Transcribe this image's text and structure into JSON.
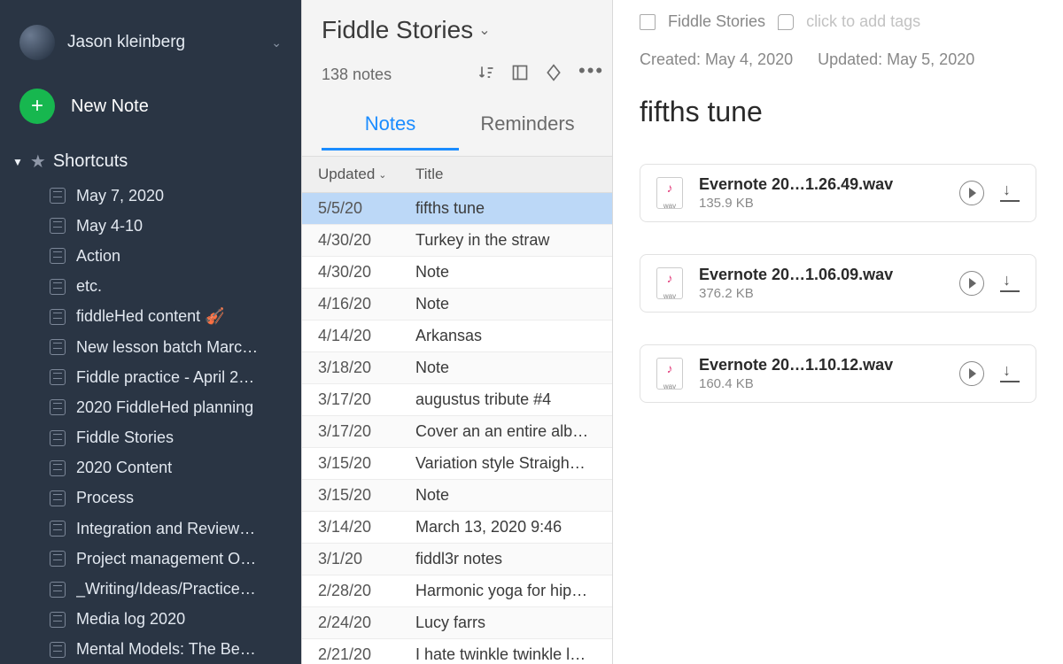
{
  "sidebar": {
    "user_name": "Jason kleinberg",
    "new_note_label": "New Note",
    "shortcuts_label": "Shortcuts",
    "items": [
      {
        "label": "May 7, 2020"
      },
      {
        "label": "May 4-10"
      },
      {
        "label": "Action"
      },
      {
        "label": "etc."
      },
      {
        "label": "fiddleHed content 🎻"
      },
      {
        "label": "New lesson batch Marc…"
      },
      {
        "label": "Fiddle practice - April 2…"
      },
      {
        "label": "2020 FiddleHed planning"
      },
      {
        "label": "Fiddle Stories"
      },
      {
        "label": "2020 Content"
      },
      {
        "label": "Process"
      },
      {
        "label": "Integration and Review…"
      },
      {
        "label": "Project management O…"
      },
      {
        "label": "_Writing/Ideas/Practice…"
      },
      {
        "label": "Media log 2020"
      },
      {
        "label": "Mental Models: The Be…"
      }
    ]
  },
  "list": {
    "notebook_title": "Fiddle Stories",
    "count_label": "138 notes",
    "tab_notes": "Notes",
    "tab_reminders": "Reminders",
    "col_updated": "Updated",
    "col_title": "Title",
    "rows": [
      {
        "date": "5/5/20",
        "title": "fifths tune",
        "selected": true
      },
      {
        "date": "4/30/20",
        "title": "Turkey in the straw"
      },
      {
        "date": "4/30/20",
        "title": "Note"
      },
      {
        "date": "4/16/20",
        "title": "Note"
      },
      {
        "date": "4/14/20",
        "title": "Arkansas"
      },
      {
        "date": "3/18/20",
        "title": "Note"
      },
      {
        "date": "3/17/20",
        "title": "augustus tribute #4"
      },
      {
        "date": "3/17/20",
        "title": "Cover an an entire alb…"
      },
      {
        "date": "3/15/20",
        "title": "Variation style Straigh…"
      },
      {
        "date": "3/15/20",
        "title": "Note"
      },
      {
        "date": "3/14/20",
        "title": "March 13, 2020 9:46"
      },
      {
        "date": "3/1/20",
        "title": "fiddl3r notes"
      },
      {
        "date": "2/28/20",
        "title": "Harmonic yoga for hip…"
      },
      {
        "date": "2/24/20",
        "title": "Lucy farrs"
      },
      {
        "date": "2/21/20",
        "title": "I hate twinkle twinkle l…"
      }
    ]
  },
  "detail": {
    "notebook_label": "Fiddle Stories",
    "tag_placeholder": "click to add tags",
    "created_label": "Created: May 4, 2020",
    "updated_label": "Updated: May 5, 2020",
    "note_title": "fifths tune",
    "attachments": [
      {
        "name": "Evernote 20…1.26.49.wav",
        "size": "135.9 KB",
        "ext": "wav"
      },
      {
        "name": "Evernote 20…1.06.09.wav",
        "size": "376.2 KB",
        "ext": "wav"
      },
      {
        "name": "Evernote 20…1.10.12.wav",
        "size": "160.4 KB",
        "ext": "wav"
      }
    ]
  }
}
